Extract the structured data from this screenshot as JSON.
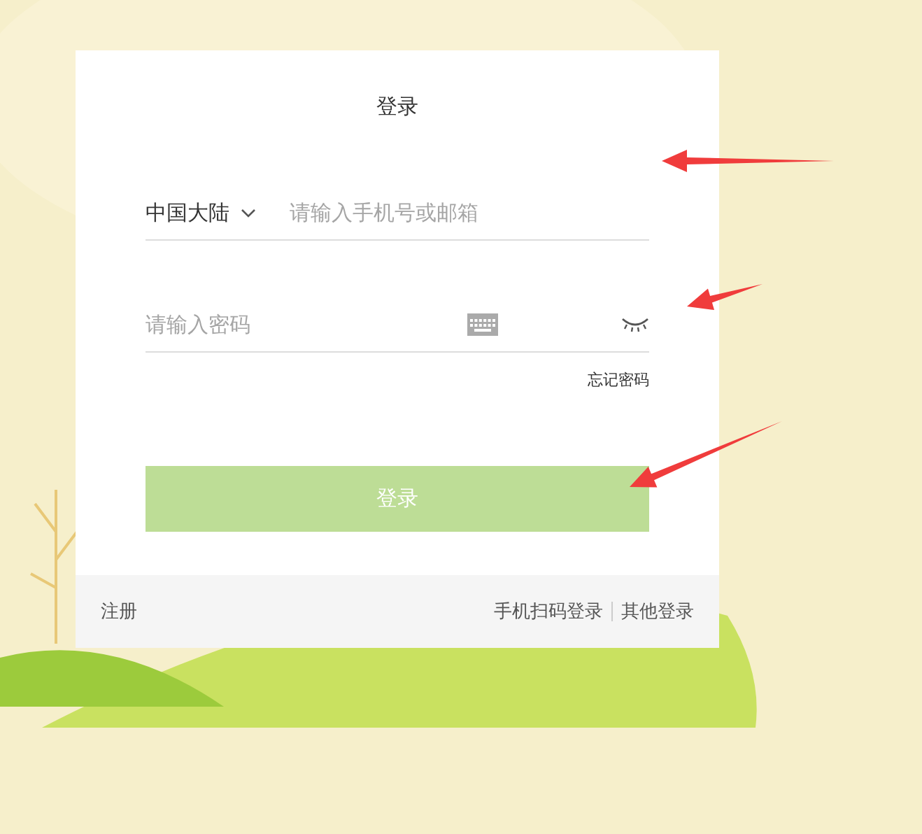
{
  "login_card": {
    "title": "登录",
    "region": {
      "value": "中国大陆"
    },
    "phone_field": {
      "placeholder": "请输入手机号或邮箱"
    },
    "password_field": {
      "placeholder": "请输入密码"
    },
    "forgot_link": "忘记密码",
    "submit_button": "登录"
  },
  "footer": {
    "register_link": "注册",
    "links": [
      "手机扫码登录",
      "其他登录"
    ]
  }
}
